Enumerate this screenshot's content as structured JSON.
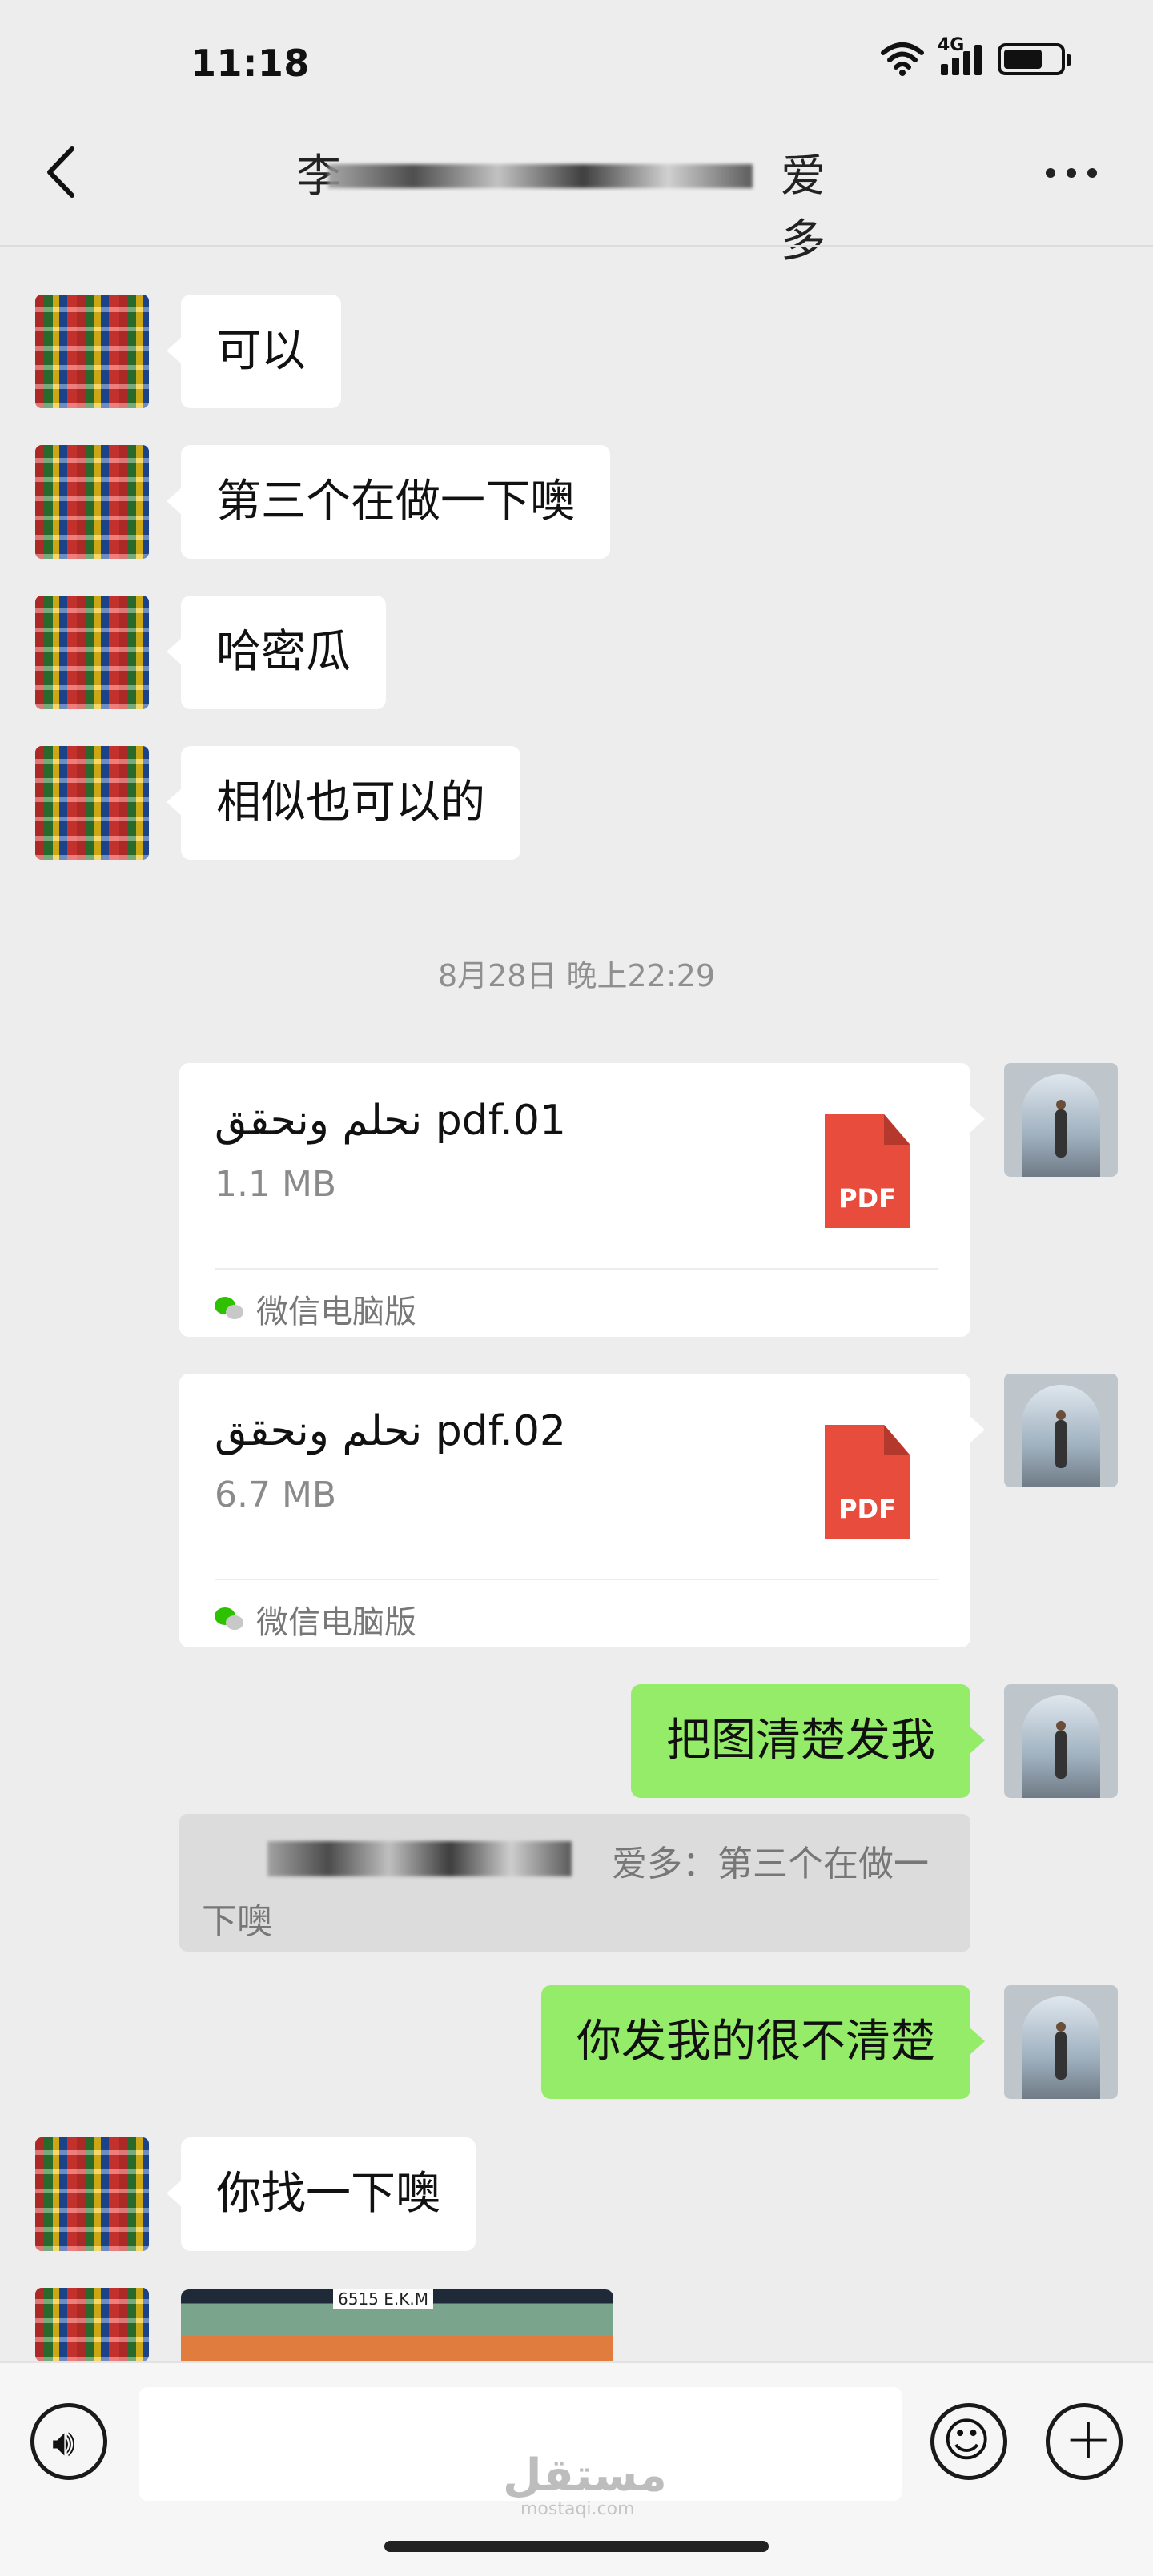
{
  "status_bar": {
    "time": "11:18",
    "network": "4G"
  },
  "header": {
    "title_start": "李",
    "title_end": "爱多"
  },
  "messages": [
    {
      "side": "left",
      "text": "可以"
    },
    {
      "side": "left",
      "text": "第三个在做一下噢"
    },
    {
      "side": "left",
      "text": "哈密瓜"
    },
    {
      "side": "left",
      "text": "相似也可以的"
    }
  ],
  "timestamp": "8月28日 晚上22:29",
  "files": [
    {
      "name": "نحلم ونحقق pdf.01",
      "size": "1.1 MB",
      "icon_label": "PDF",
      "source": "微信电脑版"
    },
    {
      "name": "نحلم ونحقق pdf.02",
      "size": "6.7 MB",
      "icon_label": "PDF",
      "source": "微信电脑版"
    }
  ],
  "sent": [
    {
      "text": "把图清楚发我"
    },
    {
      "text": "你发我的很不清楚"
    }
  ],
  "quote": {
    "line1": "爱多：第三个在做一",
    "line2": "下噢"
  },
  "after": {
    "text": "你找一下噢"
  },
  "image_label": "6515 E.K.M",
  "watermark": {
    "main": "مستقل",
    "sub": "mostaqi.com"
  },
  "colors": {
    "background": "#ededed",
    "sent_bubble": "#95ec69",
    "pdf": "#e84c3d"
  }
}
